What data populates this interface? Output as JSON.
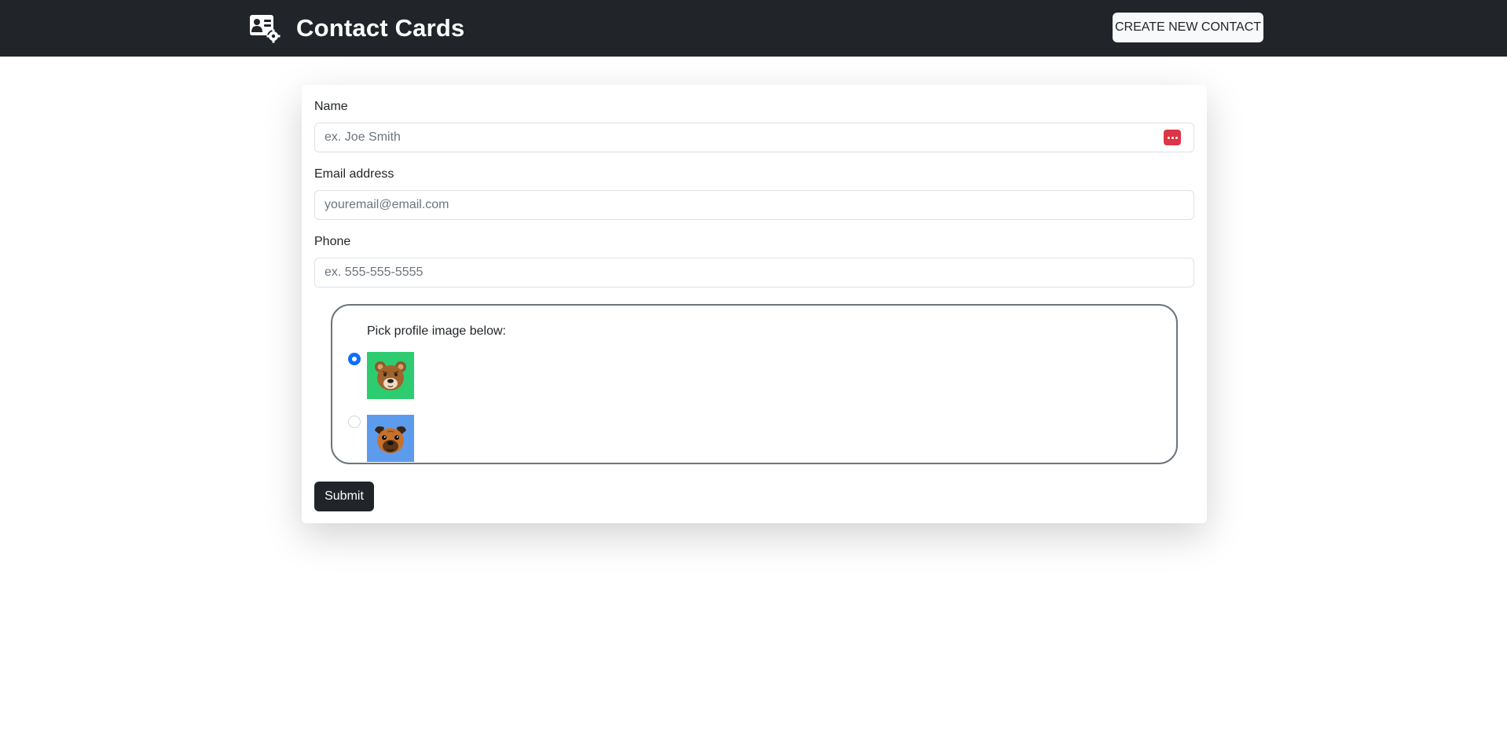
{
  "navbar": {
    "brand_title": "Contact Cards",
    "brand_icon": "contact-card-settings-icon",
    "create_button_label": "CREATE NEW CONTACT"
  },
  "form": {
    "name": {
      "label": "Name",
      "placeholder": "ex. Joe Smith",
      "value": ""
    },
    "email": {
      "label": "Email address",
      "placeholder": "youremail@email.com",
      "value": ""
    },
    "phone": {
      "label": "Phone",
      "placeholder": "ex. 555-555-5555",
      "value": ""
    },
    "profile_image": {
      "label": "Pick profile image below:",
      "options": [
        {
          "name": "bear-avatar",
          "checked": true,
          "background": "#2ecc71"
        },
        {
          "name": "pug-avatar",
          "checked": false,
          "background": "#5d9cec"
        }
      ]
    },
    "submit_label": "Submit"
  },
  "colors": {
    "navbar_bg": "#212529",
    "accent": "#0d6efd",
    "password_manager_icon": "#dc3545"
  }
}
